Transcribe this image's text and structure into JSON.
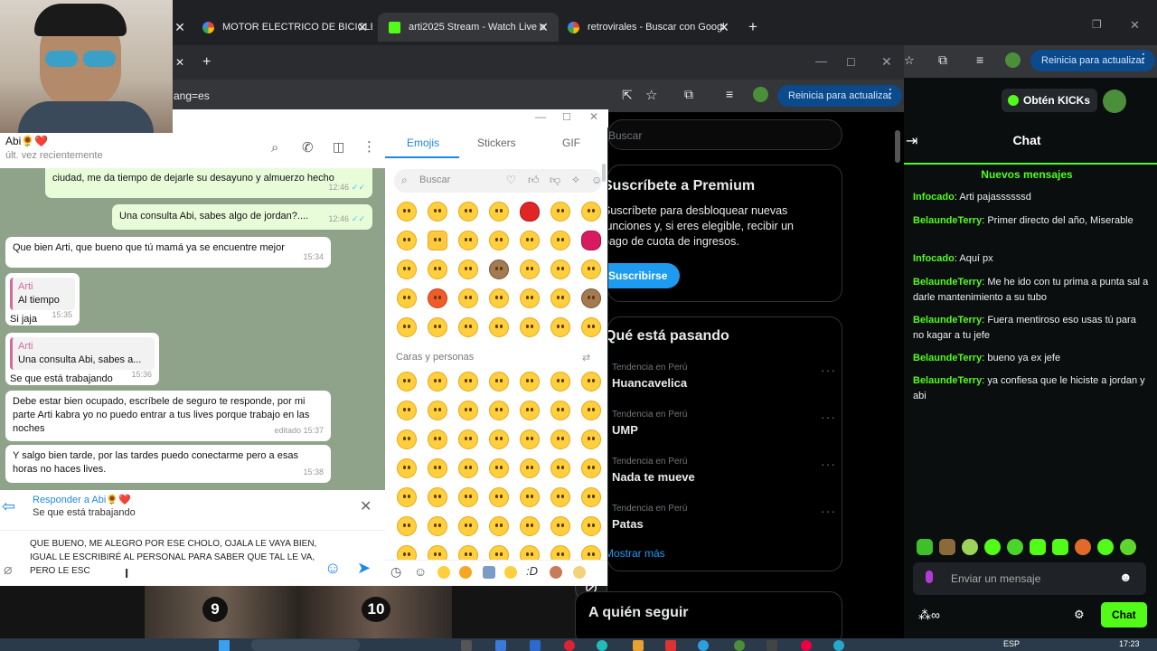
{
  "chrome": {
    "tabs": [
      {
        "title": "MOTOR ELECTRICO DE BICICLE",
        "icon": "google-icon"
      },
      {
        "title": "arti2025 Stream - Watch Live o",
        "icon": "kick-icon"
      },
      {
        "title": "retrovirales - Buscar con Googl",
        "icon": "google-icon"
      }
    ],
    "new_tab": "+",
    "url_fragment": "ang=es",
    "update_label": "Reinicia para actualizar"
  },
  "whatsapp": {
    "contact_name": "Abi🌻❤️",
    "contact_status": "últ. vez recientemente",
    "messages": [
      {
        "dir": "out",
        "text": "ciudad, me da tiempo de dejarle su desayuno y almuerzo hecho",
        "time": "12:46"
      },
      {
        "dir": "out",
        "text": "Una consulta Abi, sabes algo de jordan?....",
        "time": "12:46"
      },
      {
        "dir": "in",
        "text": "Que bien Arti, que bueno que tú mamá ya se encuentre mejor",
        "time": "15:34"
      },
      {
        "dir": "in",
        "quote_name": "Arti",
        "quote_text": "Al tiempo",
        "text": "Si jaja",
        "time": "15:35"
      },
      {
        "dir": "in",
        "quote_name": "Arti",
        "quote_text": "Una consulta Abi, sabes a...",
        "text": "Se que está trabajando",
        "time": "15:36"
      },
      {
        "dir": "in",
        "text": "Debe estar bien ocupado, escríbele de seguro te responde, por mi parte Arti kabra yo no puedo entrar a tus lives porque trabajo en las noches",
        "time": "editado 15:37"
      },
      {
        "dir": "in",
        "text": "Y salgo bien tarde, por las tardes puedo conectarme pero a esas horas no haces lives.",
        "time": "15:38"
      }
    ],
    "reply_to": "Responder a Abi🌻❤️",
    "reply_text": "Se que está trabajando",
    "draft": "QUE BUENO, ME ALEGRO POR ESE CHOLO, OJALA LE VAYA BIEN, IGUAL LE ESCRIBIRÉ AL PERSONAL PARA SABER QUE TAL LE VA, PERO LE ESC",
    "emoji_tabs": [
      "Emojis",
      "Stickers",
      "GIF"
    ],
    "emoji_search": "Buscar",
    "emoji_section": "Caras y personas"
  },
  "x": {
    "search": "Buscar",
    "premium_title": "Suscríbete a Premium",
    "premium_text": "Suscríbete para desbloquear nuevas funciones y, si eres elegible, recibir un pago de cuota de ingresos.",
    "subscribe": "Suscribirse",
    "trends_title": "Qué está pasando",
    "trends": [
      {
        "context": "Tendencia en Perú",
        "topic": "Huancavelica"
      },
      {
        "context": "Tendencia en Perú",
        "topic": "UMP"
      },
      {
        "context": "Tendencia en Perú",
        "topic": "Nada te mueve"
      },
      {
        "context": "Tendencia en Perú",
        "topic": "Patas"
      }
    ],
    "show_more": "Mostrar más",
    "follow_title": "A quién seguir"
  },
  "kick": {
    "get_kicks": "Obtén KICKs",
    "chat_title": "Chat",
    "new_messages": "Nuevos mensajes",
    "messages": [
      {
        "user": "Infocado",
        "text": "Arti pajassssssd"
      },
      {
        "user": "BelaundeTerry",
        "text": "Primer directo del año, Miserable"
      },
      {
        "user": "Infocado",
        "text": "Aquí px"
      },
      {
        "user": "BelaundeTerry",
        "text": "Me he ido con tu prima a punta sal a darle mantenimiento a su tubo"
      },
      {
        "user": "BelaundeTerry",
        "text": "Fuera mentiroso eso usas tú para no kagar a tu jefe"
      },
      {
        "user": "BelaundeTerry",
        "text": "bueno ya ex jefe"
      },
      {
        "user": "BelaundeTerry",
        "text": "ya confiesa que le hiciste a jordan y abi"
      }
    ],
    "input_placeholder": "Enviar un mensaje",
    "chat_button": "Chat"
  },
  "video_numbers": [
    "9",
    "10"
  ],
  "taskbar": {
    "lang": "ESP",
    "time": "17:23"
  },
  "colors": {
    "kick_green": "#53fc18",
    "wa_send": "#1e88e5",
    "x_blue": "#1d9bf0"
  }
}
